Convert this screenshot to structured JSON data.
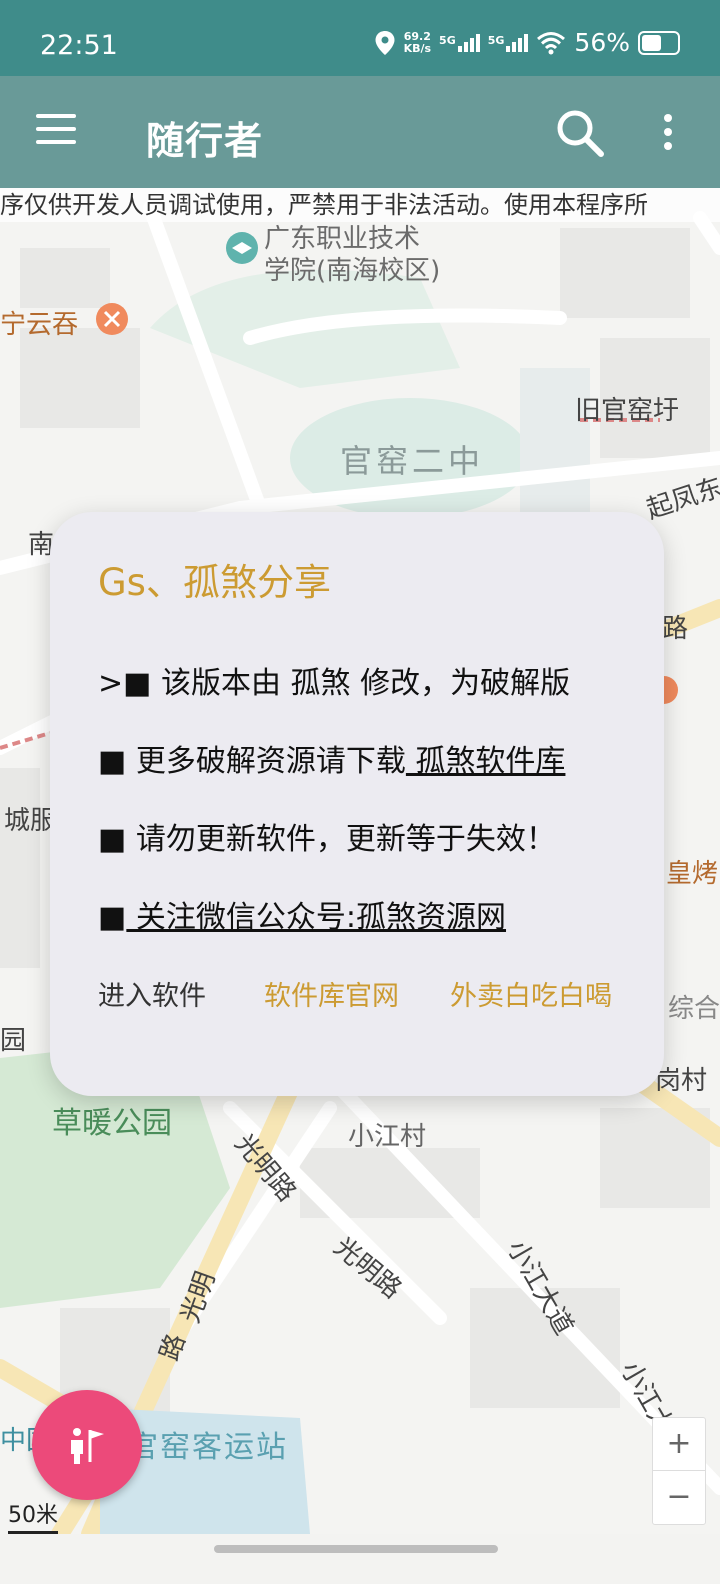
{
  "status_bar": {
    "time": "22:51",
    "net_speed_top": "69.2",
    "net_speed_bottom": "KB/s",
    "sim1": "5G",
    "sim2": "5G",
    "battery": "56%",
    "battery_level": 0.56
  },
  "app_bar": {
    "title": "随行者"
  },
  "map": {
    "ticker": "序仅供开发人员调试使用，严禁用于非法活动。使用本程序所",
    "labels": {
      "school": "广东职业技术",
      "school2": "学院(南海校区)",
      "restaurant": "宁云吞",
      "old_village": "旧官窑圩",
      "school_zhong": "官窑二中",
      "qifeng": "起凤东",
      "nan": "南",
      "lu": "路",
      "cheng": "城服",
      "huangkao": "皇烤",
      "zonghe": "综合",
      "yuan": "园",
      "gangcun": "岗村",
      "park": "草暖公园",
      "xiaojiang": "小江村",
      "guangming1": "光明路",
      "guangming2": "光明路",
      "guangming3": "光明",
      "guangming4": "路",
      "xiaojiang_ave": "小江大道",
      "xiaojiang_ave2": "小江大",
      "zhongguo": "中国",
      "bus_station": "官窑客运站"
    },
    "scale": "50米",
    "zoom_in": "+",
    "zoom_out": "−"
  },
  "dialog": {
    "title": "Gs、孤煞分享",
    "line1": ">■ 该版本由 孤煞 修改，为破解版",
    "line2_prefix": "■ 更多破解资源请下载",
    "line2_link": " 孤煞软件库 ",
    "line3": "■ 请勿更新软件，更新等于失效！",
    "line4_prefix": "■",
    "line4_link": " 关注微信公众号:孤煞资源网 ",
    "buttons": {
      "enter": "进入软件",
      "website": "软件库官网",
      "takeout": "外卖白吃白喝"
    }
  },
  "colors": {
    "status_bar": "#3f8c8a",
    "app_bar": "#699a98",
    "accent": "#cc9b32",
    "fab": "#ec4a7a"
  }
}
